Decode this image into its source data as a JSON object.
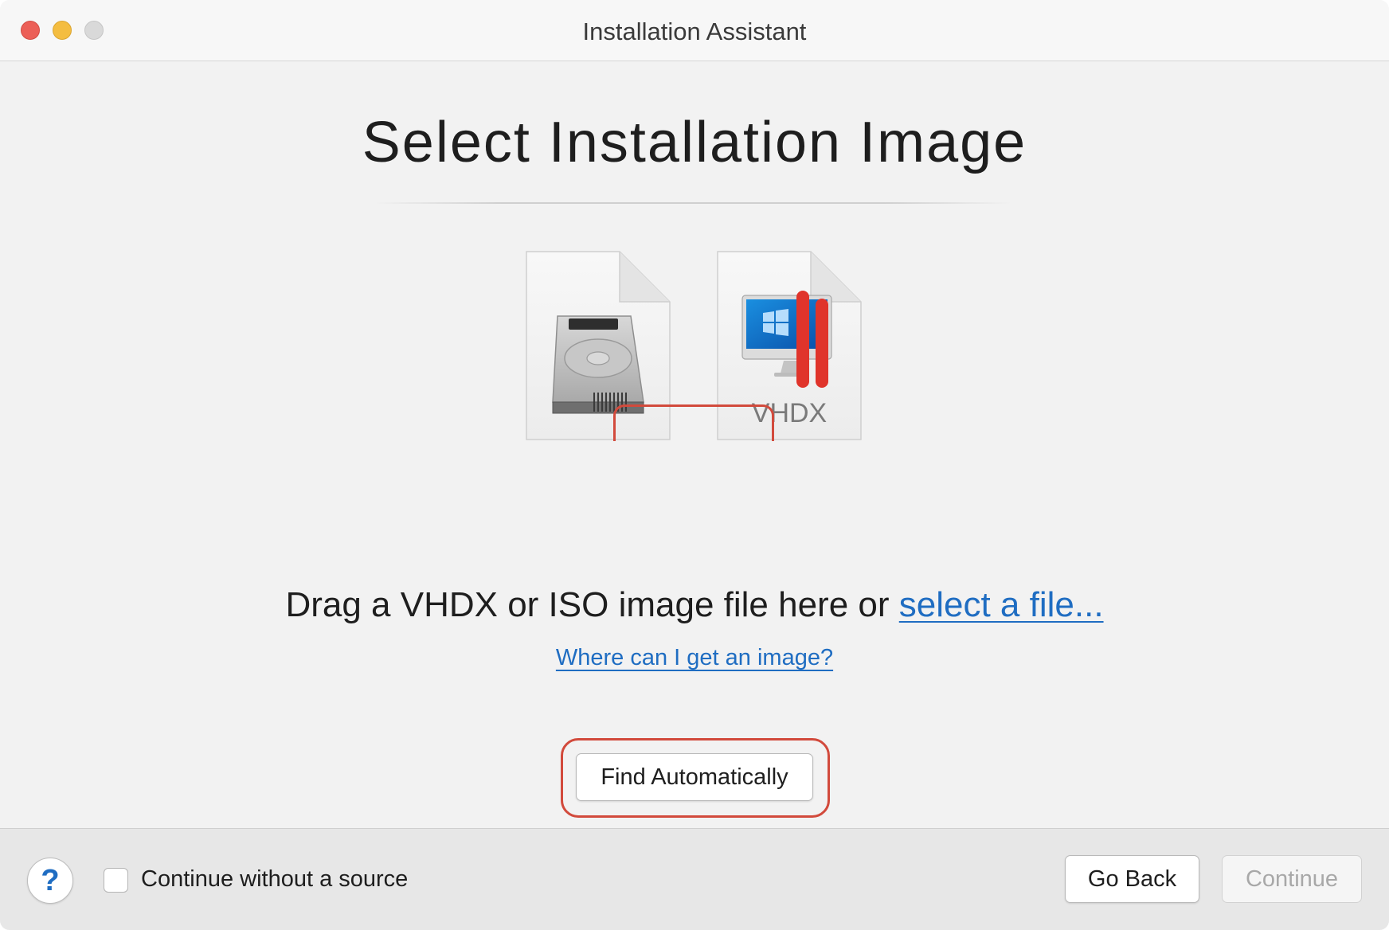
{
  "window": {
    "title": "Installation Assistant"
  },
  "main": {
    "heading": "Select Installation Image",
    "files": [
      {
        "icon": "hard-disk-icon",
        "label": ""
      },
      {
        "icon": "parallels-windows-vhdx-icon",
        "label": "VHDX"
      }
    ],
    "drag_text": "Drag a VHDX or ISO image file here or ",
    "select_file_link": "select a file...",
    "where_link": "Where can I get an image?",
    "find_button": "Find Automatically",
    "highlight_color": "#d24a3c"
  },
  "footer": {
    "help_label": "?",
    "continue_without_source_label": "Continue without a source",
    "continue_without_source_checked": false,
    "go_back_label": "Go Back",
    "continue_label": "Continue",
    "continue_enabled": false
  },
  "colors": {
    "link": "#1f6dc2",
    "close": "#ec5f57",
    "minimize": "#f4bd40",
    "zoom_disabled": "#d9d9d9"
  }
}
